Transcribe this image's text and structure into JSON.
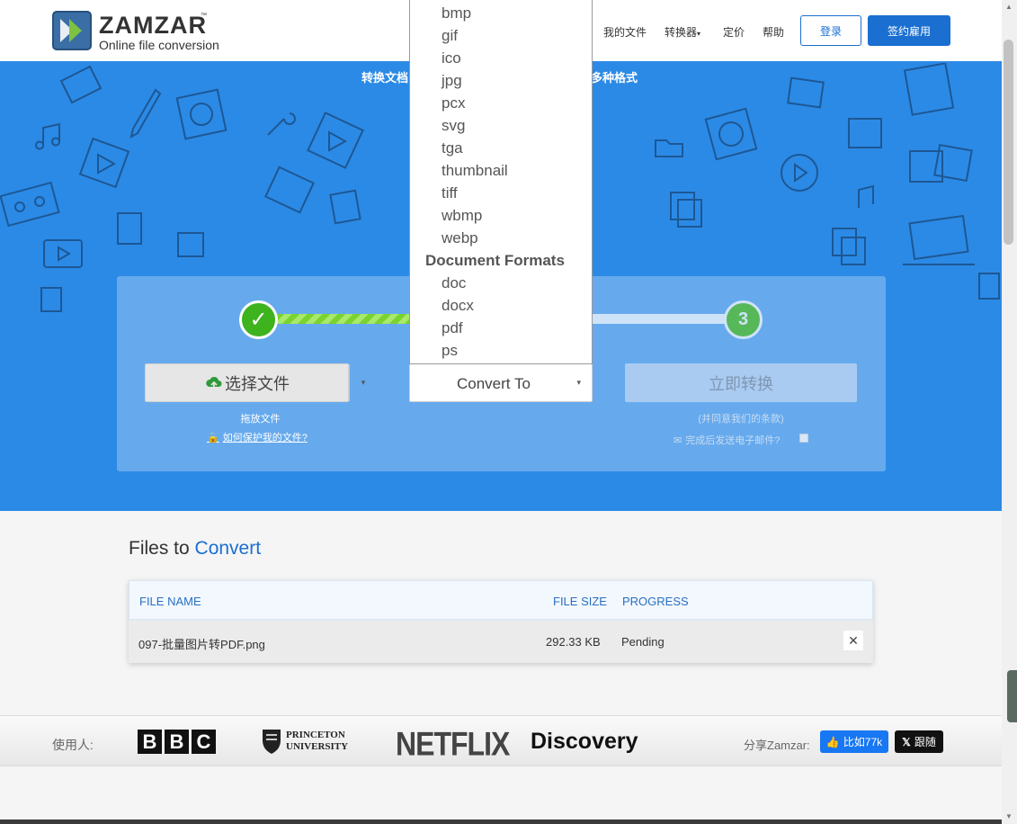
{
  "header": {
    "logo_name": "ZAMZAR",
    "logo_tm": "™",
    "logo_tagline": "Online file conversion",
    "nav": [
      "我的文件",
      "转换器",
      "定价",
      "帮助"
    ],
    "nav_caret": "▾",
    "login": "登录",
    "signup": "签约雇用"
  },
  "hero": {
    "tagline_left": "转换文档",
    "tagline_right": "多种格式",
    "step1_mark": "✓",
    "step3_number": "3",
    "choose_file": "选择文件",
    "choose_caret": "▾",
    "drop_files": "拖放文件",
    "protect_link": "如何保护我的文件?",
    "convert_to": "Convert To",
    "convert_caret": "▾",
    "convert_now": "立即转换",
    "terms": "(并同意我们的条款)",
    "email_prompt": "完成后发送电子邮件?"
  },
  "dropdown": {
    "image_items": [
      "bmp",
      "gif",
      "ico",
      "jpg",
      "pcx",
      "svg",
      "tga",
      "thumbnail",
      "tiff",
      "wbmp",
      "webp"
    ],
    "group_document": "Document Formats",
    "document_items": [
      "doc",
      "docx",
      "pdf",
      "ps"
    ]
  },
  "files": {
    "title_prefix": "Files to",
    "title_accent": "Convert",
    "columns": {
      "name": "FILE NAME",
      "size": "FILE SIZE",
      "progress": "PROGRESS"
    },
    "rows": [
      {
        "name": "097-批量图片转PDF.png",
        "size": "292.33 KB",
        "progress": "Pending",
        "close": "✕"
      }
    ]
  },
  "users": {
    "label": "使用人:",
    "bbc": [
      "B",
      "B",
      "C"
    ],
    "princeton_line1": "PRINCETON",
    "princeton_line2": "UNIVERSITY",
    "netflix": "NETFLIX",
    "discovery": "Discovery",
    "share_label": "分享Zamzar:",
    "fb_like": "比如77k",
    "x_follow": "跟随"
  },
  "colors": {
    "brand_blue": "#1a6fd1",
    "hero_blue": "#2b8ae6",
    "progress_green": "#3db31e"
  }
}
